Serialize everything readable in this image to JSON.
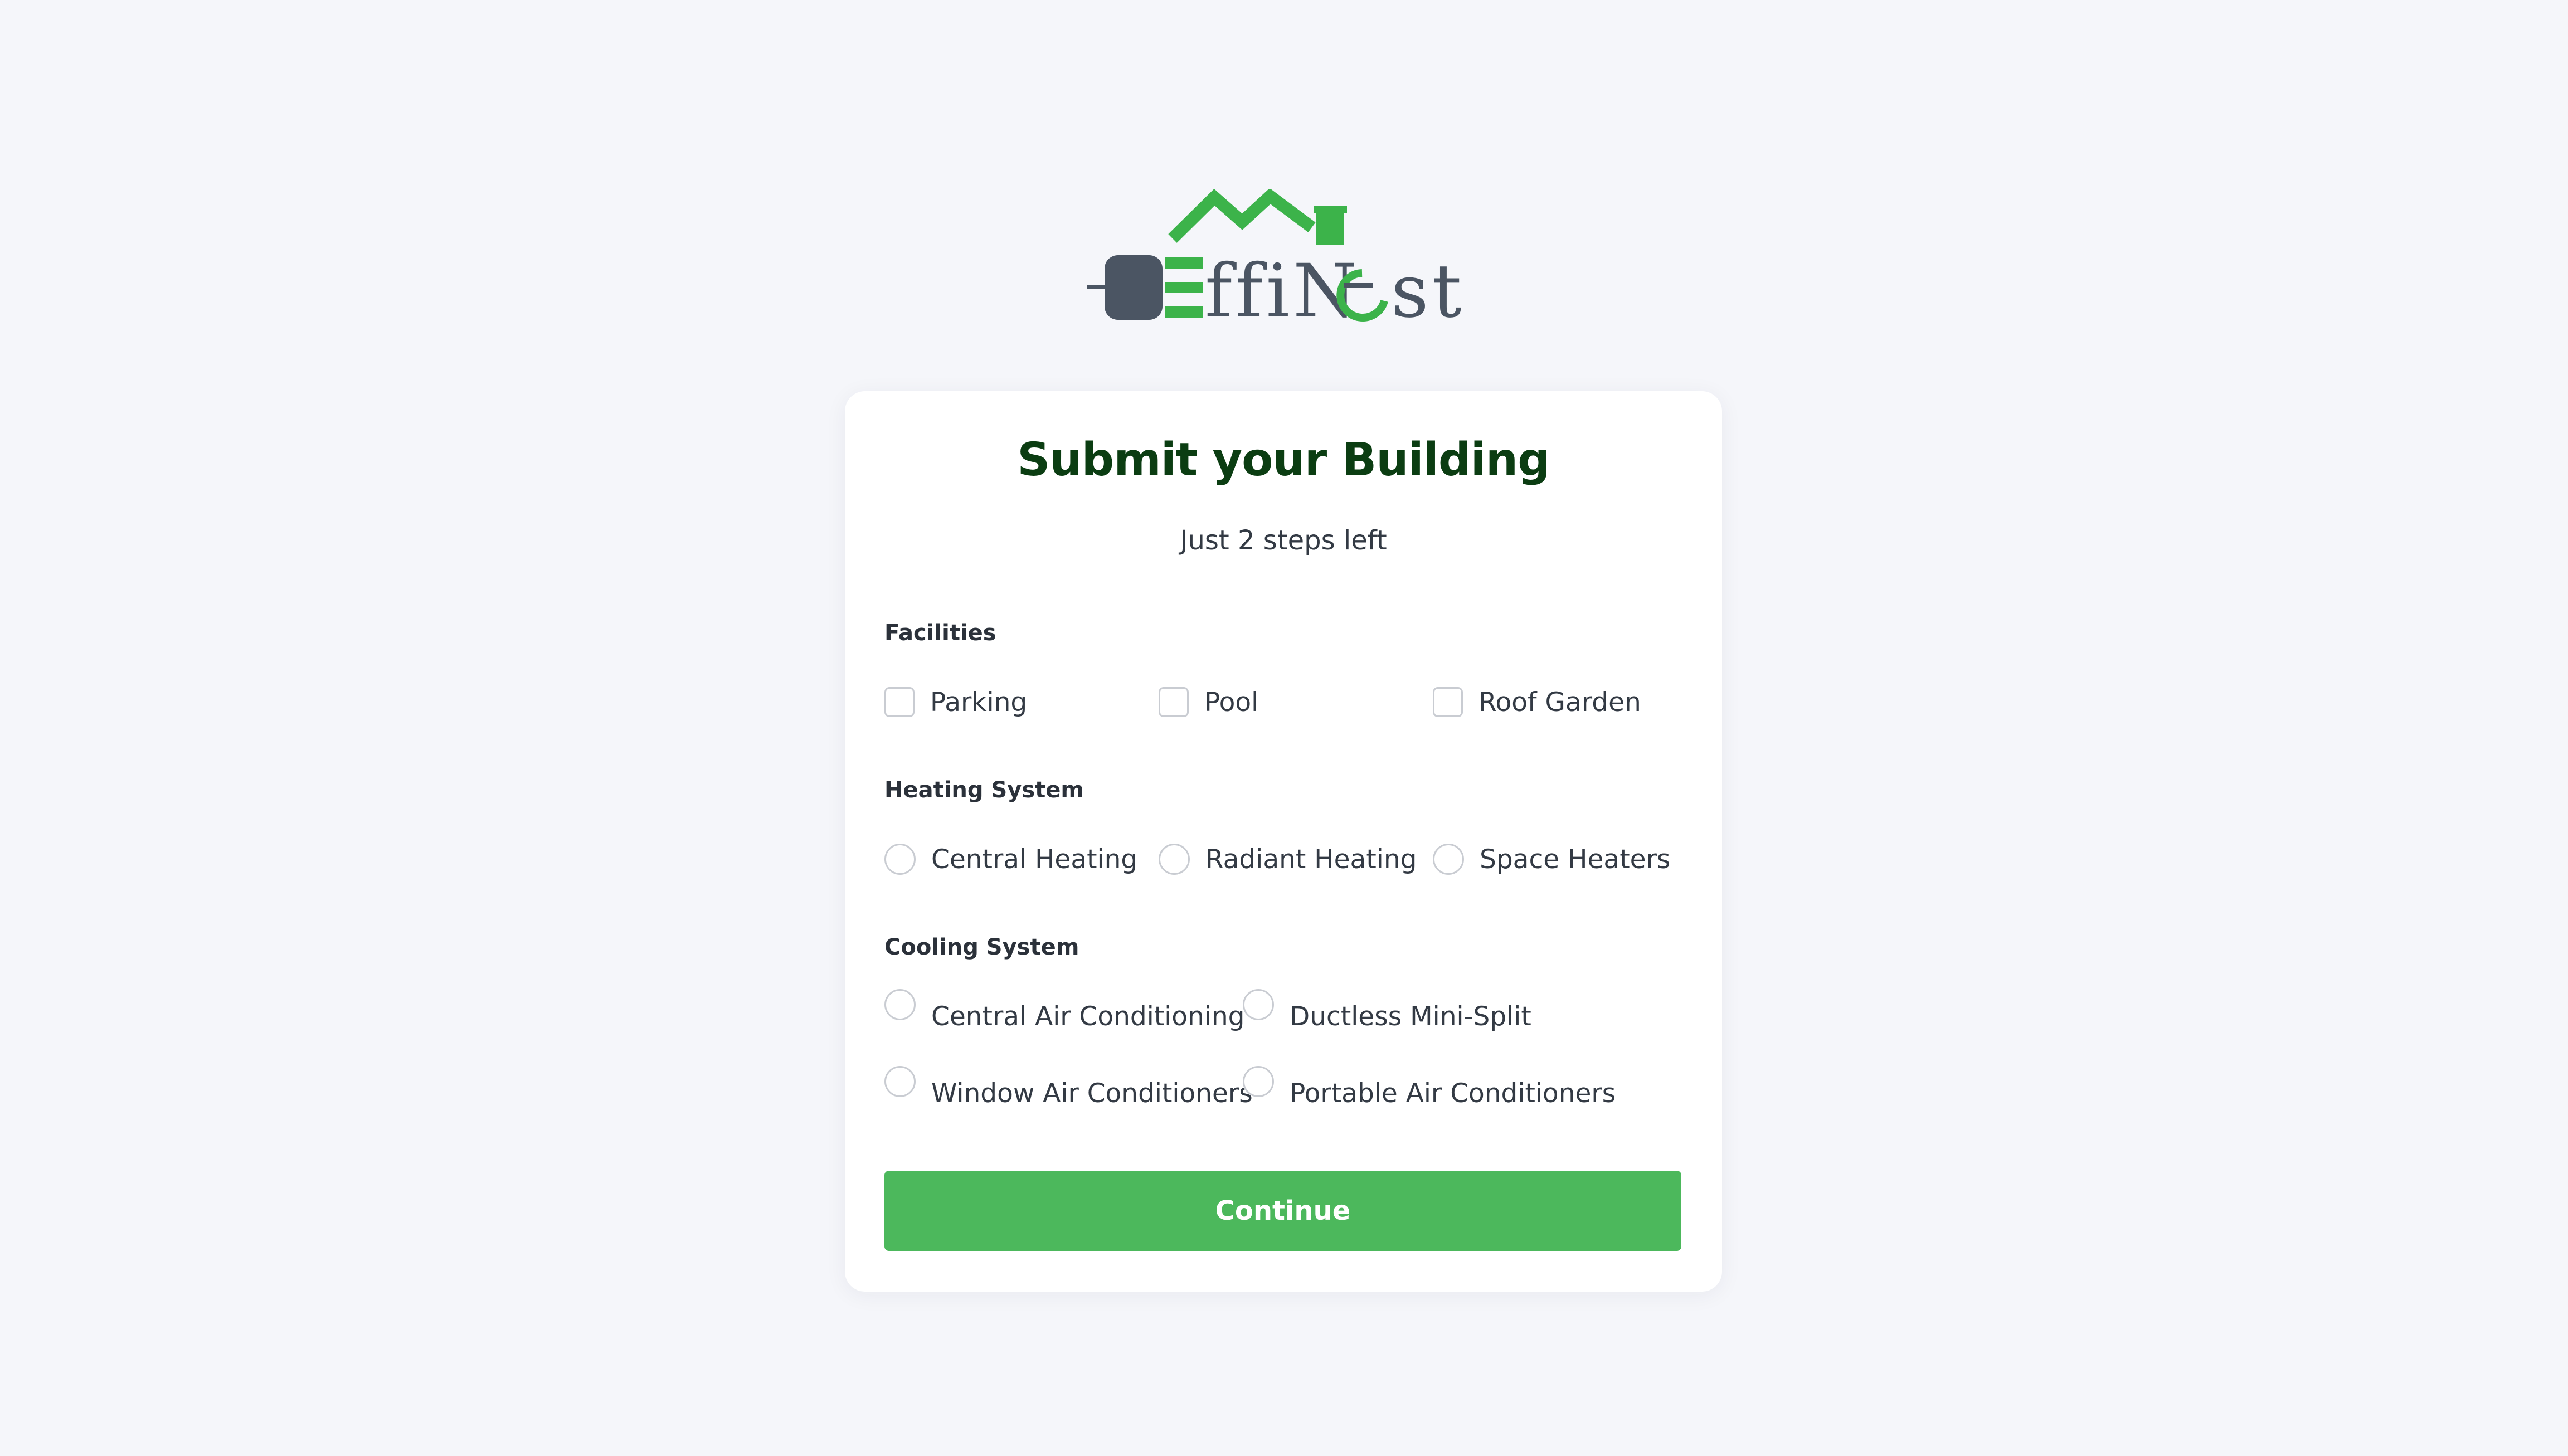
{
  "brand": {
    "name": "EffiNest",
    "colors": {
      "green": "#3cb34a",
      "slate": "#4b5563"
    }
  },
  "card": {
    "title": "Submit your Building",
    "subtitle": "Just 2 steps left"
  },
  "facilities": {
    "label": "Facilities",
    "options": [
      "Parking",
      "Pool",
      "Roof Garden"
    ]
  },
  "heating": {
    "label": "Heating System",
    "options": [
      "Central Heating",
      "Radiant Heating",
      "Space Heaters"
    ]
  },
  "cooling": {
    "label": "Cooling System",
    "options": [
      "Central Air Conditioning",
      "Ductless Mini-Split",
      "Window Air Conditioners",
      "Portable Air Conditioners"
    ]
  },
  "actions": {
    "continue_label": "Continue"
  },
  "colors": {
    "background": "#f5f6fa",
    "title": "#0b3d12",
    "accent": "#4cb85c"
  }
}
